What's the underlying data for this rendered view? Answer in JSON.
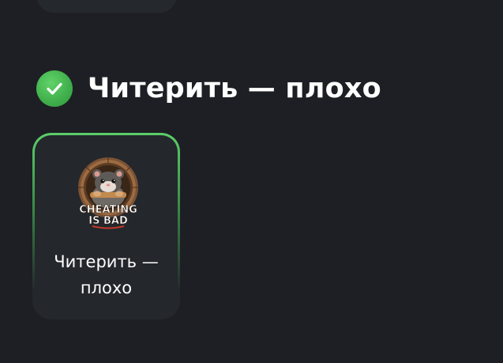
{
  "section": {
    "icon": "check-circle-icon",
    "title": "Читерить — плохо",
    "accent_color": "#4cbf58"
  },
  "card": {
    "image": "hamster-cheating-is-bad-badge",
    "image_text": "CHEATING IS BAD",
    "label_line1": "Читерить —",
    "label_line2": "плохо"
  }
}
